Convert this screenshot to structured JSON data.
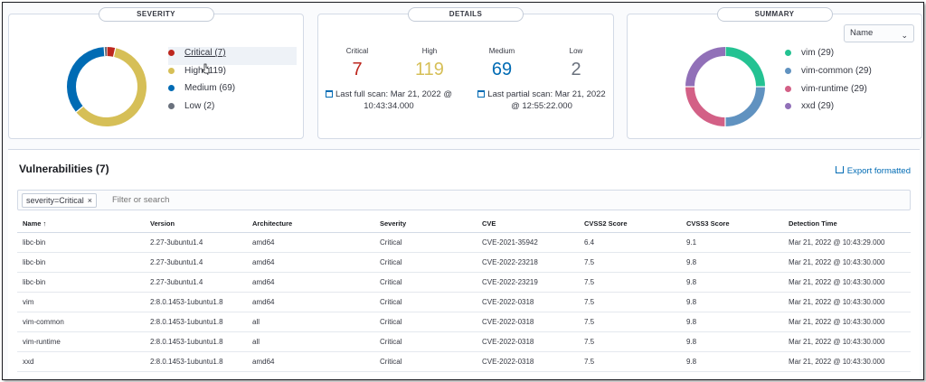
{
  "severity_panel": {
    "title": "SEVERITY",
    "items": [
      {
        "label": "Critical (7)",
        "color": "#bd271e",
        "value": 7
      },
      {
        "label": "High (119)",
        "color": "#d6bf57",
        "value": 119
      },
      {
        "label": "Medium (69)",
        "color": "#006bb4",
        "value": 69
      },
      {
        "label": "Low (2)",
        "color": "#6a717d",
        "value": 2
      }
    ]
  },
  "details_panel": {
    "title": "DETAILS",
    "stats": [
      {
        "label": "Critical",
        "value": "7",
        "color": "#bd271e"
      },
      {
        "label": "High",
        "value": "119",
        "color": "#d6bf57"
      },
      {
        "label": "Medium",
        "value": "69",
        "color": "#006bb4"
      },
      {
        "label": "Low",
        "value": "2",
        "color": "#6a717d"
      }
    ],
    "full_scan": "Last full scan: Mar 21, 2022 @ 10:43:34.000",
    "partial_scan": "Last partial scan: Mar 21, 2022 @ 12:55:22.000"
  },
  "summary_panel": {
    "title": "SUMMARY",
    "select_value": "Name",
    "items": [
      {
        "label": "vim (29)",
        "color": "#24c292",
        "value": 29
      },
      {
        "label": "vim-common (29)",
        "color": "#6092c0",
        "value": 29
      },
      {
        "label": "vim-runtime (29)",
        "color": "#d36086",
        "value": 29
      },
      {
        "label": "xxd (29)",
        "color": "#9170b8",
        "value": 29
      }
    ]
  },
  "vulnerabilities": {
    "title": "Vulnerabilities (7)",
    "export_label": "Export formatted",
    "filter_chip": "severity=Critical",
    "filter_placeholder": "Filter or search",
    "columns": [
      "Name ↑",
      "Version",
      "Architecture",
      "Severity",
      "CVE",
      "CVSS2 Score",
      "CVSS3 Score",
      "Detection Time"
    ],
    "rows": [
      [
        "libc-bin",
        "2.27-3ubuntu1.4",
        "amd64",
        "Critical",
        "CVE-2021-35942",
        "6.4",
        "9.1",
        "Mar 21, 2022 @ 10:43:29.000"
      ],
      [
        "libc-bin",
        "2.27-3ubuntu1.4",
        "amd64",
        "Critical",
        "CVE-2022-23218",
        "7.5",
        "9.8",
        "Mar 21, 2022 @ 10:43:30.000"
      ],
      [
        "libc-bin",
        "2.27-3ubuntu1.4",
        "amd64",
        "Critical",
        "CVE-2022-23219",
        "7.5",
        "9.8",
        "Mar 21, 2022 @ 10:43:30.000"
      ],
      [
        "vim",
        "2:8.0.1453-1ubuntu1.8",
        "amd64",
        "Critical",
        "CVE-2022-0318",
        "7.5",
        "9.8",
        "Mar 21, 2022 @ 10:43:30.000"
      ],
      [
        "vim-common",
        "2:8.0.1453-1ubuntu1.8",
        "all",
        "Critical",
        "CVE-2022-0318",
        "7.5",
        "9.8",
        "Mar 21, 2022 @ 10:43:30.000"
      ],
      [
        "vim-runtime",
        "2:8.0.1453-1ubuntu1.8",
        "all",
        "Critical",
        "CVE-2022-0318",
        "7.5",
        "9.8",
        "Mar 21, 2022 @ 10:43:30.000"
      ],
      [
        "xxd",
        "2:8.0.1453-1ubuntu1.8",
        "amd64",
        "Critical",
        "CVE-2022-0318",
        "7.5",
        "9.8",
        "Mar 21, 2022 @ 10:43:30.000"
      ]
    ]
  }
}
